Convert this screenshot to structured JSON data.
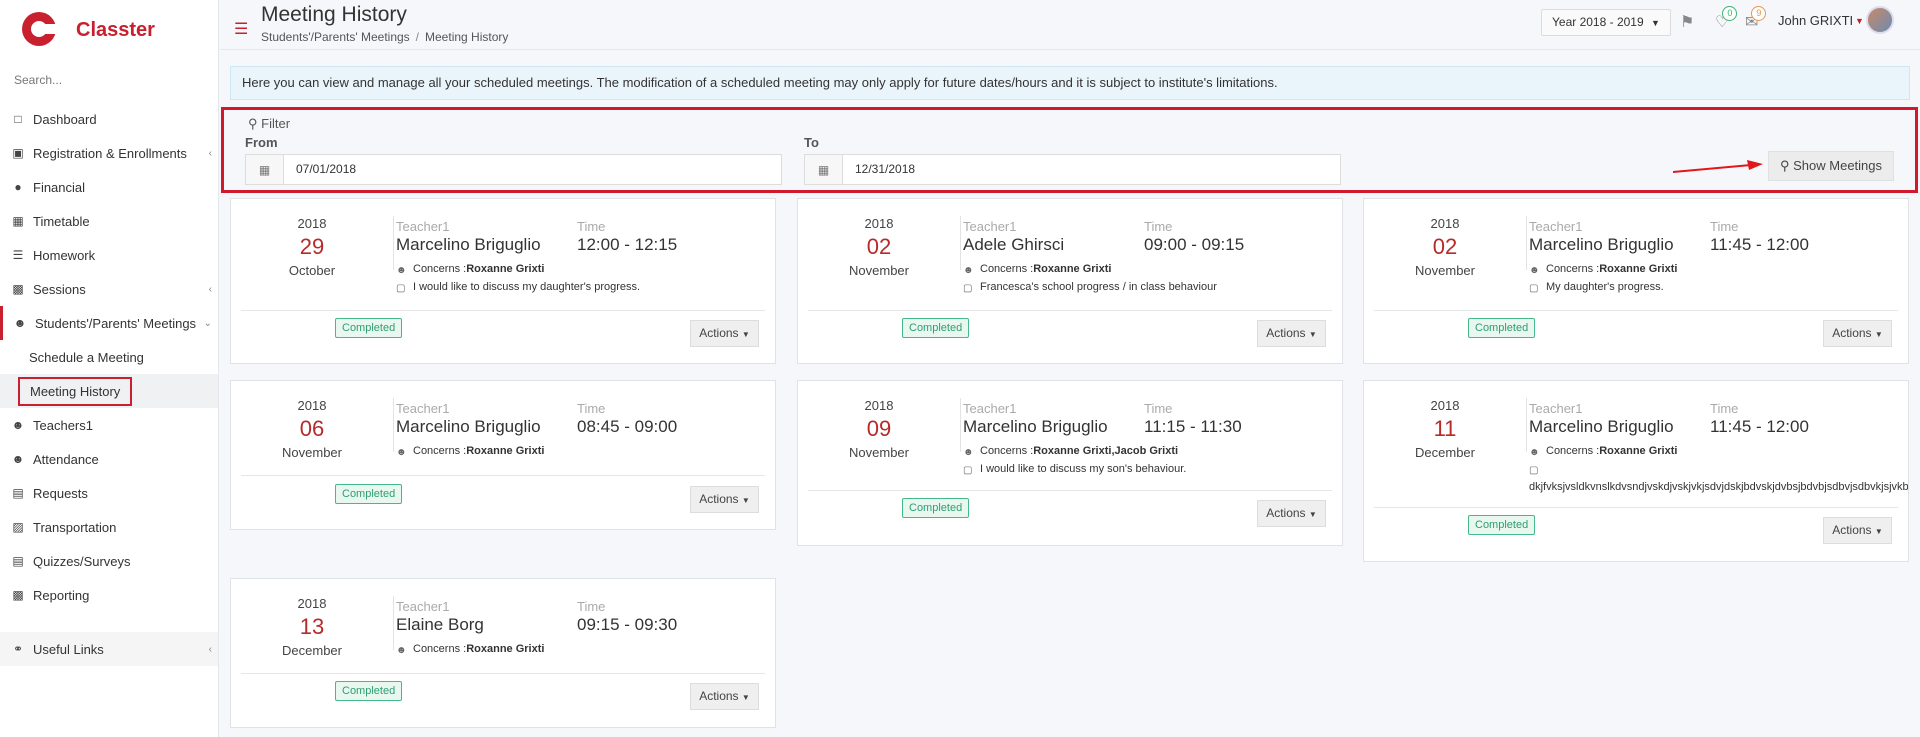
{
  "app": {
    "name": "Classter"
  },
  "sidebar": {
    "search_placeholder": "Search...",
    "items": [
      {
        "label": "Dashboard",
        "icon": "laptop-icon"
      },
      {
        "label": "Registration & Enrollments",
        "icon": "institution-icon"
      },
      {
        "label": "Financial",
        "icon": "coins-icon"
      },
      {
        "label": "Timetable",
        "icon": "calendar-icon"
      },
      {
        "label": "Homework",
        "icon": "list-icon"
      },
      {
        "label": "Sessions",
        "icon": "sessions-icon"
      },
      {
        "label": "Students'/Parents' Meetings",
        "icon": "users-gear-icon"
      }
    ],
    "sub_items": [
      {
        "label": "Schedule a Meeting"
      },
      {
        "label": "Meeting History"
      }
    ],
    "items_after": [
      {
        "label": "Teachers1",
        "icon": "users-icon"
      },
      {
        "label": "Attendance",
        "icon": "user-check-icon"
      },
      {
        "label": "Requests",
        "icon": "document-icon"
      },
      {
        "label": "Transportation",
        "icon": "bus-icon"
      },
      {
        "label": "Quizzes/Surveys",
        "icon": "clipboard-icon"
      },
      {
        "label": "Reporting",
        "icon": "printer-icon"
      }
    ],
    "useful_links": "Useful Links"
  },
  "header": {
    "title": "Meeting History",
    "breadcrumb": [
      "Students'/Parents' Meetings",
      "Meeting History"
    ],
    "year_select": "Year 2018 - 2019",
    "notifications_count": "0",
    "messages_count": "9",
    "user_name": "John GRIXTI"
  },
  "info": "Here you can view and manage all your scheduled meetings. The modification of a scheduled meeting may only apply for future dates/hours and it is subject to institute's limitations.",
  "filter": {
    "title": "Filter",
    "from_label": "From",
    "from_value": "07/01/2018",
    "to_label": "To",
    "to_value": "12/31/2018",
    "show_button": "Show Meetings"
  },
  "labels": {
    "teacher": "Teacher1",
    "time": "Time",
    "concerns": "Concerns :",
    "actions": "Actions"
  },
  "meetings": [
    {
      "year": "2018",
      "day": "29",
      "month": "October",
      "teacher": "Marcelino Briguglio",
      "time": "12:00 - 12:15",
      "concerns": "Roxanne Grixti",
      "note": "I would like to discuss my daughter's progress.",
      "status": "Completed"
    },
    {
      "year": "2018",
      "day": "02",
      "month": "November",
      "teacher": "Adele Ghirsci",
      "time": "09:00 - 09:15",
      "concerns": "Roxanne Grixti",
      "note": "Francesca's school progress / in class behaviour",
      "status": "Completed"
    },
    {
      "year": "2018",
      "day": "02",
      "month": "November",
      "teacher": "Marcelino Briguglio",
      "time": "11:45 - 12:00",
      "concerns": "Roxanne Grixti",
      "note": "My daughter's progress.",
      "status": "Completed"
    },
    {
      "year": "2018",
      "day": "06",
      "month": "November",
      "teacher": "Marcelino Briguglio",
      "time": "08:45 - 09:00",
      "concerns": "Roxanne Grixti",
      "note": "",
      "status": "Completed"
    },
    {
      "year": "2018",
      "day": "09",
      "month": "November",
      "teacher": "Marcelino Briguglio",
      "time": "11:15 - 11:30",
      "concerns": "Roxanne Grixti,Jacob Grixti",
      "note": "I would like to discuss my son's behaviour.",
      "status": "Completed"
    },
    {
      "year": "2018",
      "day": "11",
      "month": "December",
      "teacher": "Marcelino Briguglio",
      "time": "11:45 - 12:00",
      "concerns": "Roxanne Grixti",
      "note": "dkjfvksjvsldkvnslkdvsndjvskdjvskjvkjsdvjdskjbdvskjdvbsjbdvbjsdbvjsdbvkjsjvkbj",
      "status": "Completed"
    },
    {
      "year": "2018",
      "day": "13",
      "month": "December",
      "teacher": "Elaine Borg",
      "time": "09:15 - 09:30",
      "concerns": "Roxanne Grixti",
      "note": "",
      "status": "Completed"
    }
  ]
}
